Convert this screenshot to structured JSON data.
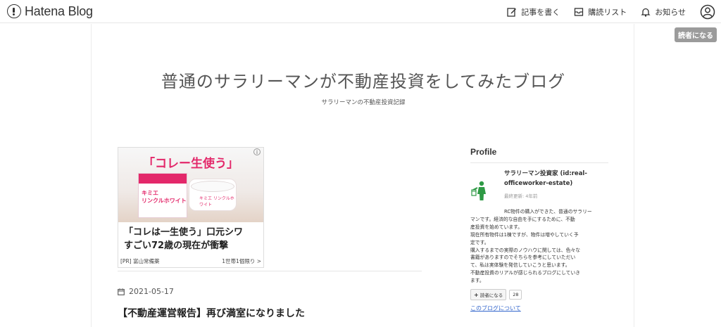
{
  "header": {
    "logo_text": "Hatena Blog",
    "nav": {
      "write_label": "記事を書く",
      "subscriptions_label": "購読リスト",
      "notifications_label": "お知らせ"
    },
    "follow_label": "読者になる"
  },
  "blog": {
    "title": "普通のサラリーマンが不動産投資をしてみたブログ",
    "description": "サラリーマンの不動産投資記録"
  },
  "ad": {
    "headline": "「コレー生使う」",
    "info_icon": "i",
    "product_line1": "キミエ",
    "product_line2": "リンクルホワイト",
    "jar_label": "キミエ リンクルホワイト",
    "text_line1": "「コレは一生使う」口元シワ",
    "text_line2": "すごい72歳の現在が衝撃",
    "sponsor": "[PR] 富山常備薬",
    "cta": "1世帯1個限り >"
  },
  "post": {
    "date": "2021-05-17",
    "title": "【不動産運営報告】再び満室になりました"
  },
  "sidebar": {
    "heading": "Profile",
    "name": "サラリーマン投資家 (id:real-officeworker-estate)",
    "updated": "最終更新: 4年前",
    "bio_lines": [
      "RC物件の購入ができた、普通のサラリー",
      "マンです。経済的な自由を手にするために、不動",
      "産投資を始めています。",
      "現在所有物件は1棟ですが、物件は増やしていく予",
      "定です。",
      "購入するまでの実際のノウハウに関しては、色々な",
      "書籍がありますのでそちらを参考にしていただい",
      "て、私は実体験を発信していこうと思います。",
      "不動産投資のリアルが感じられるブログにしていき",
      "ます。"
    ],
    "follow_button": "読者になる",
    "follow_count": "28",
    "about_link": "このブログについて"
  },
  "colors": {
    "ad_accent": "#e3286a",
    "profile_icon": "#2e9a45",
    "link": "#3366cc"
  }
}
